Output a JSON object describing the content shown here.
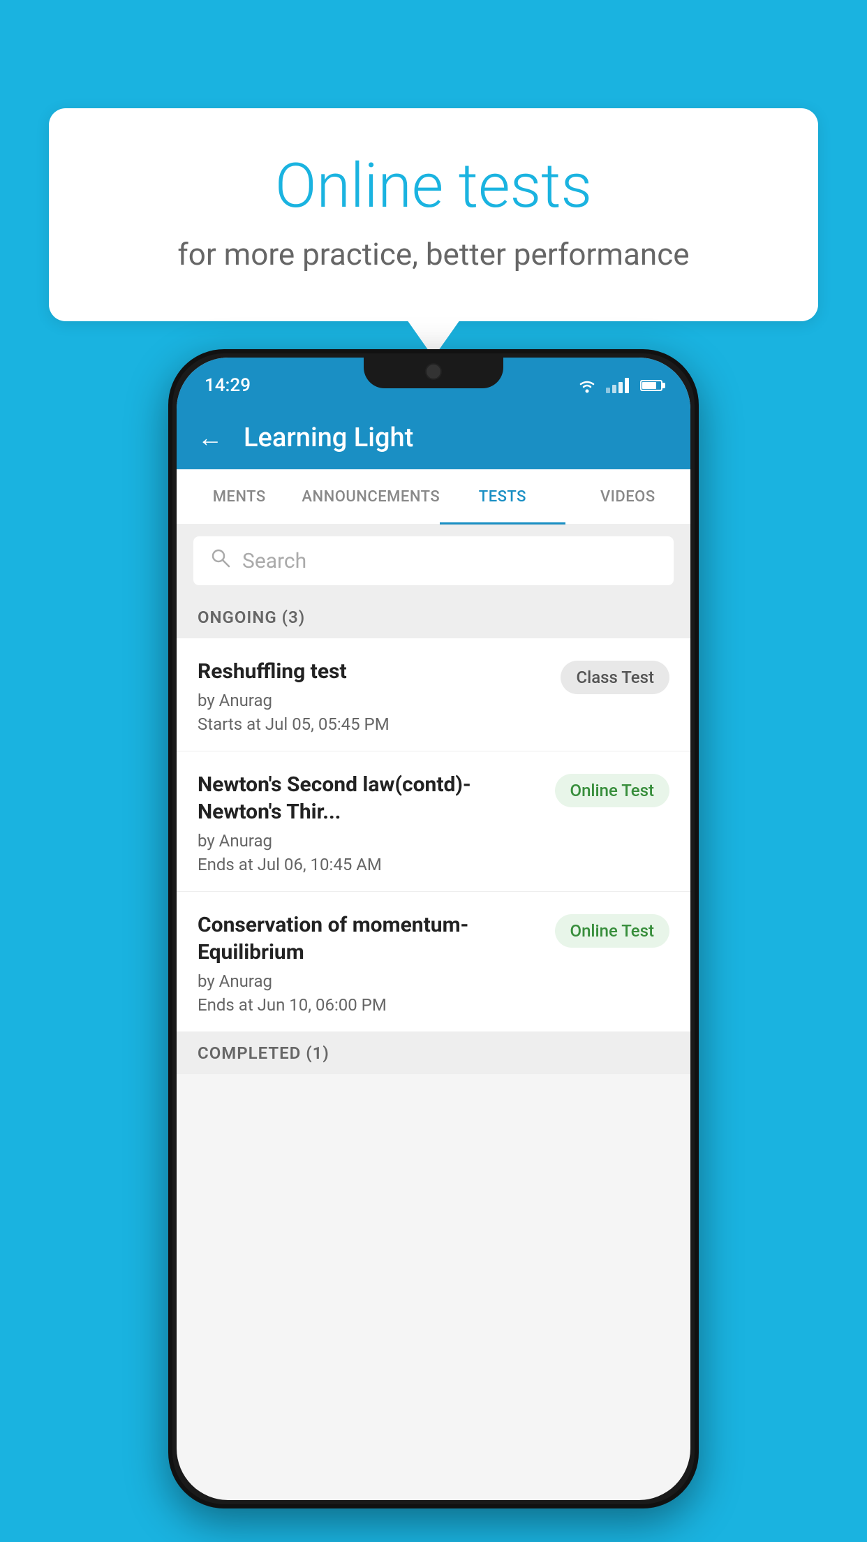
{
  "background_color": "#1ab3e0",
  "speech_bubble": {
    "title": "Online tests",
    "subtitle": "for more practice, better performance"
  },
  "phone": {
    "status_bar": {
      "time": "14:29"
    },
    "header": {
      "title": "Learning Light",
      "back_label": "←"
    },
    "tabs": [
      {
        "label": "MENTS",
        "active": false
      },
      {
        "label": "ANNOUNCEMENTS",
        "active": false
      },
      {
        "label": "TESTS",
        "active": true
      },
      {
        "label": "VIDEOS",
        "active": false
      }
    ],
    "search": {
      "placeholder": "Search"
    },
    "ongoing_section": {
      "label": "ONGOING (3)"
    },
    "tests": [
      {
        "name": "Reshuffling test",
        "author": "by Anurag",
        "time": "Starts at  Jul 05, 05:45 PM",
        "badge": "Class Test",
        "badge_type": "class"
      },
      {
        "name": "Newton's Second law(contd)-Newton's Thir...",
        "author": "by Anurag",
        "time": "Ends at  Jul 06, 10:45 AM",
        "badge": "Online Test",
        "badge_type": "online"
      },
      {
        "name": "Conservation of momentum-Equilibrium",
        "author": "by Anurag",
        "time": "Ends at  Jun 10, 06:00 PM",
        "badge": "Online Test",
        "badge_type": "online"
      }
    ],
    "completed_section": {
      "label": "COMPLETED (1)"
    }
  }
}
